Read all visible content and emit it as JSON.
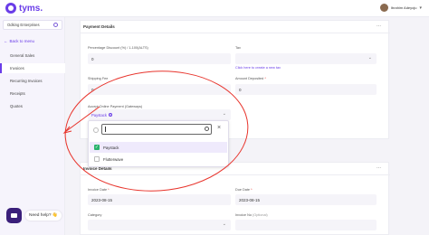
{
  "app": {
    "brand": "tyms."
  },
  "user": {
    "name": "Ibrahim Adeyoju"
  },
  "sidebar": {
    "business": "Odking Enterprises",
    "back_label": "Back to menu",
    "items": [
      {
        "label": "General Sales"
      },
      {
        "label": "Invoices"
      },
      {
        "label": "Recurring Invoices"
      },
      {
        "label": "Receipts"
      },
      {
        "label": "Quotes"
      }
    ]
  },
  "payment": {
    "title": "Payment Details",
    "menu_dots": "...",
    "discount_label": "Percentage Discount (%) / 1-100(ALTS)",
    "discount_value": "0",
    "tax_label": "Tax",
    "tax_link": "Click here to create a new tax",
    "shipping_label": "Shipping Fee",
    "shipping_value": "0",
    "amount_deposited_label": "Amount Deposited",
    "required_mark": "*",
    "amount_deposited_value": "0",
    "online_payment_label": "Accept Online Payment (Gateways)",
    "online_payment_selected": "Paystack"
  },
  "dropdown": {
    "search_value": "",
    "close": "×",
    "options": [
      {
        "label": "Paystack",
        "checked": true
      },
      {
        "label": "Flutterwave",
        "checked": false
      }
    ]
  },
  "invoice": {
    "title": "Invoice Details",
    "menu_dots": "...",
    "invoice_date_label": "Invoice Date",
    "invoice_date_value": "2023-08-15",
    "due_date_label": "Due Date",
    "due_date_value": "2023-08-15",
    "category_label": "Category",
    "invoice_no_label": "Invoice No",
    "optional": "(Optional)"
  },
  "help": {
    "label": "Need help? 👋"
  },
  "colors": {
    "brand": "#6a3de8",
    "annotation": "#e8342c",
    "checked": "#29b36c",
    "chat_button": "#3a1f7a"
  }
}
